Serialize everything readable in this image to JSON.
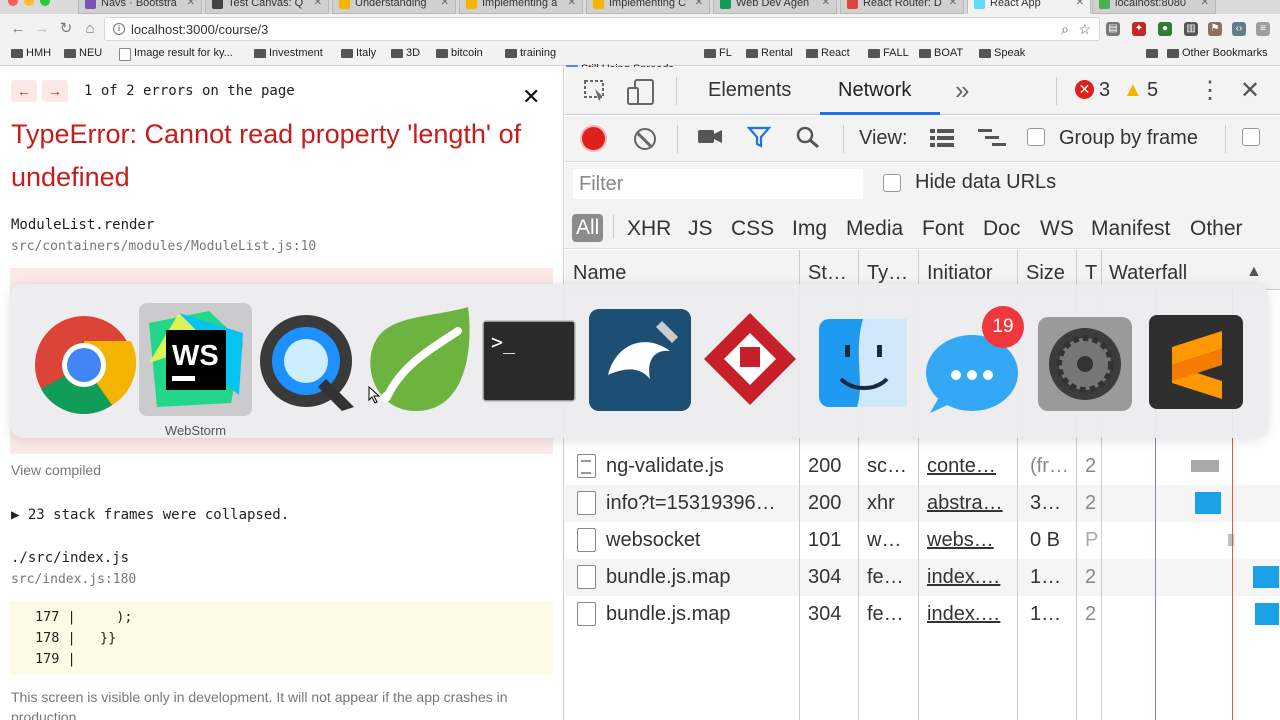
{
  "browser": {
    "tabs": [
      {
        "label": "Navs · Bootstra",
        "fav": "#7952b3",
        "active": false
      },
      {
        "label": "Test Canvas: Q",
        "fav": "#444",
        "active": false
      },
      {
        "label": "Understanding",
        "fav": "#f5b400",
        "active": false
      },
      {
        "label": "Implementing a",
        "fav": "#f5b400",
        "active": false
      },
      {
        "label": "Implementing C",
        "fav": "#f5b400",
        "active": false
      },
      {
        "label": "Web Dev Agen",
        "fav": "#0f9d58",
        "active": false
      },
      {
        "label": "React Router: D",
        "fav": "#d44",
        "active": false
      },
      {
        "label": "React App",
        "fav": "#61dafb",
        "active": true
      },
      {
        "label": "localhost:8080",
        "fav": "#4caf50",
        "active": false
      }
    ],
    "url": "localhost:3000/course/3",
    "bookmarks": [
      {
        "label": "HMH",
        "kind": "folder"
      },
      {
        "label": "NEU",
        "kind": "folder"
      },
      {
        "label": "Image result for ky...",
        "kind": "file"
      },
      {
        "label": "Investment",
        "kind": "folder"
      },
      {
        "label": "Italy",
        "kind": "folder"
      },
      {
        "label": "3D",
        "kind": "folder"
      },
      {
        "label": "bitcoin",
        "kind": "folder"
      },
      {
        "label": "training",
        "kind": "folder"
      },
      {
        "label": "Still Using Spreads...",
        "kind": "app"
      },
      {
        "label": "FL",
        "kind": "folder"
      },
      {
        "label": "Rental",
        "kind": "folder"
      },
      {
        "label": "React",
        "kind": "folder"
      },
      {
        "label": "FALL",
        "kind": "folder"
      },
      {
        "label": "BOAT",
        "kind": "folder"
      },
      {
        "label": "Speak",
        "kind": "folder"
      }
    ],
    "overflow_chevron": "»",
    "other_bookmarks": "Other Bookmarks"
  },
  "error_overlay": {
    "prev_arrow": "←",
    "next_arrow": "→",
    "count_text": "1 of 2 errors on the page",
    "close_symbol": "✕",
    "title": "TypeError: Cannot read property 'length' of undefined",
    "frame1_fn": "ModuleList.render",
    "frame1_loc": "src/containers/modules/ModuleList.js:10",
    "view_compiled": "View compiled",
    "collapsed": "▶ 23 stack frames were collapsed.",
    "frame2_fn": "./src/index.js",
    "frame2_loc": "src/index.js:180",
    "code_lines": [
      "177 |     );",
      "178 |   }}",
      "179 |"
    ],
    "footer": "This screen is visible only in development. It will not appear if the app crashes in production."
  },
  "devtools": {
    "tabs": {
      "elements": "Elements",
      "network": "Network",
      "more": "»"
    },
    "error_count": "3",
    "warning_count": "5",
    "view_label": "View:",
    "group_by_frame": "Group by frame",
    "filter_placeholder": "Filter",
    "hide_data_urls": "Hide data URLs",
    "types": [
      "All",
      "XHR",
      "JS",
      "CSS",
      "Img",
      "Media",
      "Font",
      "Doc",
      "WS",
      "Manifest",
      "Other"
    ],
    "columns": {
      "name": "Name",
      "status": "St…",
      "type": "Ty…",
      "initiator": "Initiator",
      "size": "Size",
      "time": "T",
      "waterfall": "Waterfall"
    },
    "rows": [
      {
        "name": "ng-validate.js",
        "status": "200",
        "type": "sc…",
        "initiator": "conte…",
        "size": "(fr…",
        "time": "2",
        "wf_color": "#a9a9a9"
      },
      {
        "name": "info?t=15319396…",
        "status": "200",
        "type": "xhr",
        "initiator": "abstra…",
        "size": "3…",
        "time": "2",
        "wf_color": "#1aa1e6"
      },
      {
        "name": "websocket",
        "status": "101",
        "type": "w…",
        "initiator": "webs…",
        "size": "0 B",
        "time": "P",
        "wf_color": "#c0c0c0"
      },
      {
        "name": "bundle.js.map",
        "status": "304",
        "type": "fe…",
        "initiator": "index.…",
        "size": "1…",
        "time": "2",
        "wf_color": "#1aa1e6"
      },
      {
        "name": "bundle.js.map",
        "status": "304",
        "type": "fe…",
        "initiator": "index.…",
        "size": "1…",
        "time": "2",
        "wf_color": "#1aa1e6"
      }
    ]
  },
  "app_switcher": {
    "selected_label": "WebStorm",
    "messages_badge": "19",
    "apps": [
      "chrome-icon",
      "webstorm-icon",
      "quicktime-icon",
      "spring-icon",
      "terminal-icon",
      "mysql-workbench-icon",
      "wps-office-icon",
      "finder-icon",
      "messages-icon",
      "system-preferences-icon",
      "sublime-text-icon"
    ]
  }
}
